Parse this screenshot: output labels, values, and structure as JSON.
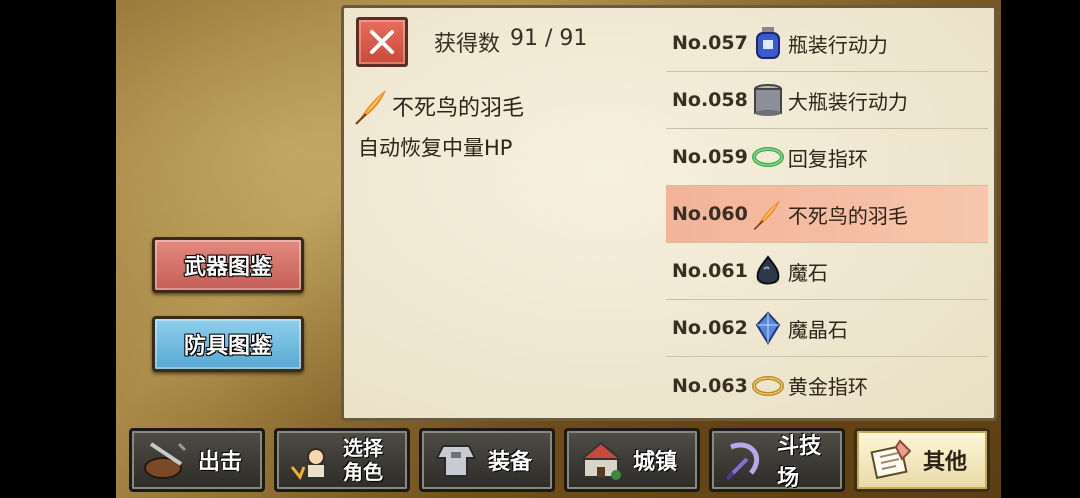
{
  "side": {
    "weapons_label": "武器图鉴",
    "armor_label": "防具图鉴"
  },
  "panel": {
    "count_label": "获得数",
    "count_value": "91 / 91",
    "selected_name": "不死鸟的羽毛",
    "selected_desc": "自动恢复中量HP",
    "selected_icon": "phoenix-feather-icon"
  },
  "items": [
    {
      "no": "No.057",
      "name": "瓶装行动力",
      "icon": "blue-bottle-icon"
    },
    {
      "no": "No.058",
      "name": "大瓶装行动力",
      "icon": "large-jar-icon"
    },
    {
      "no": "No.059",
      "name": "回复指环",
      "icon": "green-ring-icon"
    },
    {
      "no": "No.060",
      "name": "不死鸟的羽毛",
      "icon": "phoenix-feather-icon"
    },
    {
      "no": "No.061",
      "name": "魔石",
      "icon": "dark-stone-icon"
    },
    {
      "no": "No.062",
      "name": "魔晶石",
      "icon": "blue-crystal-icon"
    },
    {
      "no": "No.063",
      "name": "黄金指环",
      "icon": "gold-ring-icon"
    }
  ],
  "nav": [
    {
      "label": "出击",
      "icon": "sortie-icon"
    },
    {
      "label_line1": "选择",
      "label_line2": "角色",
      "icon": "character-icon"
    },
    {
      "label": "装备",
      "icon": "armor-icon"
    },
    {
      "label": "城镇",
      "icon": "town-icon"
    },
    {
      "label": "斗技场",
      "icon": "arena-icon"
    },
    {
      "label": "其他",
      "icon": "scroll-icon"
    }
  ],
  "colors": {
    "selected_row": "#f7c6ac",
    "weapons_btn": "#d9756b",
    "armor_btn": "#72bde2"
  }
}
